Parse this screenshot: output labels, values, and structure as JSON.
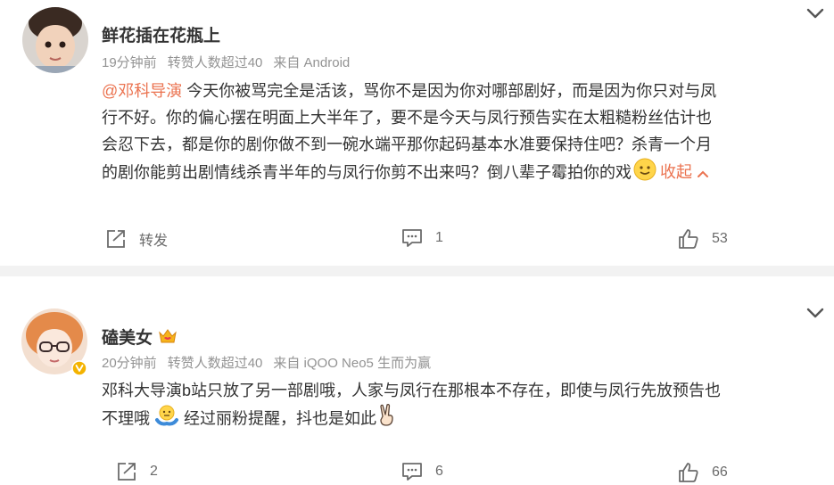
{
  "comments": [
    {
      "username": "鲜花插在花瓶上",
      "time": "19分钟前",
      "likes_badge": "转赞人数超过40",
      "source": "来自 Android",
      "mention": "@邓科导演",
      "lines": [
        "今天你被骂完全是活该，骂你不是因为你对哪部剧好，而是因为你只对与凤",
        "行不好。你的偏心摆在明面上大半年了，要不是今天与凤行预告实在太粗糙粉丝估计也",
        "会忍下去，都是你的剧你做不到一碗水端平那你起码基本水准要保持住吧？杀青一个月",
        "的剧你能剪出剧情线杀青半年的与凤行你剪不出来吗？倒八辈子霉拍你的戏"
      ],
      "collapse_label": "收起",
      "repost_label": "转发",
      "comment_count": "1",
      "like_count": "53"
    },
    {
      "username": "磕美女",
      "time": "20分钟前",
      "likes_badge": "转赞人数超过40",
      "source": "来自 iQOO Neo5 生而为赢",
      "lines": [
        "邓科大导演b站只放了另一部剧哦，人家与凤行在那根本不存在，即使与凤行先放预告也",
        "不理哦",
        "经过丽粉提醒，抖也是如此"
      ],
      "repost_count": "2",
      "comment_count": "6",
      "like_count": "66"
    }
  ],
  "colors": {
    "accent": "#eb7350",
    "meta": "#939393",
    "separator": "#f2f2f2",
    "text": "#333333"
  },
  "icons": [
    "chevron-down-icon",
    "repost-icon",
    "comment-icon",
    "like-icon",
    "smile-emoji",
    "shrug-emoji",
    "peace-hand-emoji",
    "crown-badge-icon",
    "verified-badge-icon"
  ]
}
